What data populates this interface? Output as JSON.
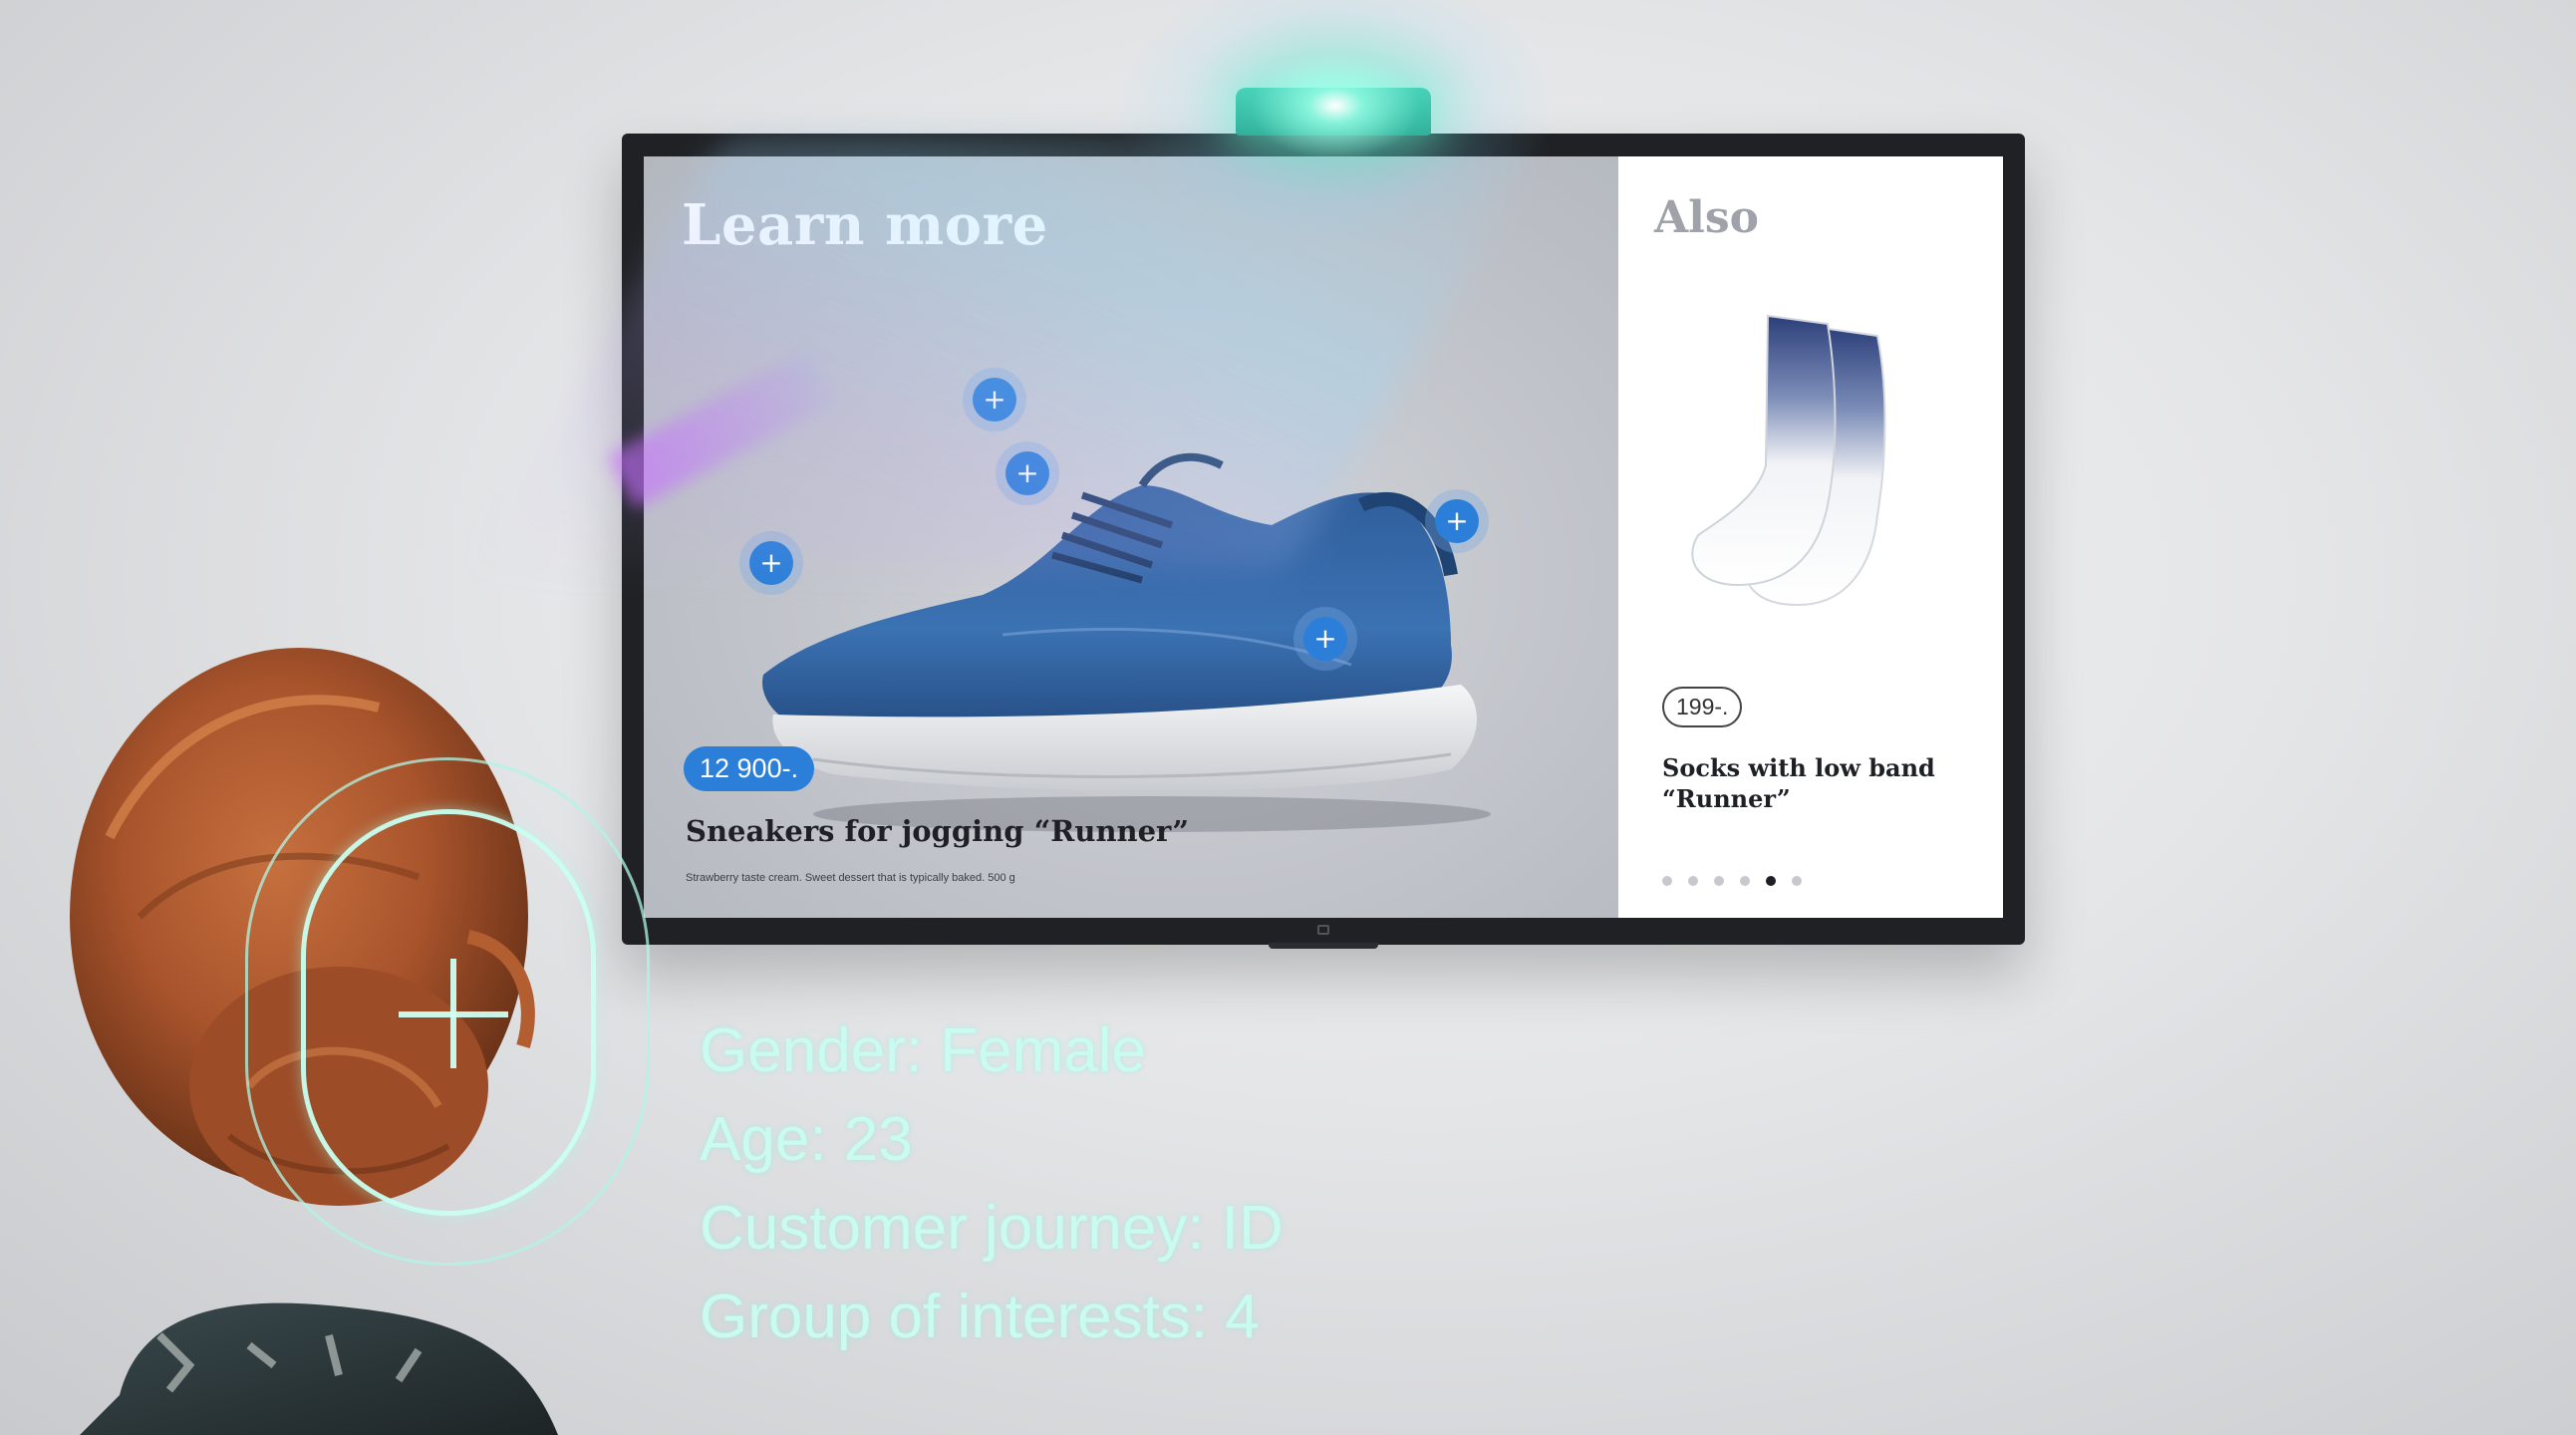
{
  "screen": {
    "main": {
      "title": "Learn more",
      "price": "12 900-.",
      "product_name": "Sneakers for jogging “Runner”",
      "description": "Strawberry taste cream. Sweet dessert that is typically baked. 500 g"
    },
    "side": {
      "title": "Also",
      "price": "199-.",
      "product_name": "Socks with low band “Runner”",
      "carousel": {
        "count": 6,
        "active_index": 4
      }
    }
  },
  "viewer": {
    "gender": "Gender: Female",
    "age": "Age: 23",
    "journey": "Customer journey: ID",
    "interests": "Group of interests: 4"
  },
  "icons": [
    "camera-icon",
    "plus-icon",
    "face-detection-icon"
  ],
  "colors": {
    "accent": "#2b7fd8",
    "overlay_text": "#c9fbf1",
    "camera": "#27b096"
  }
}
